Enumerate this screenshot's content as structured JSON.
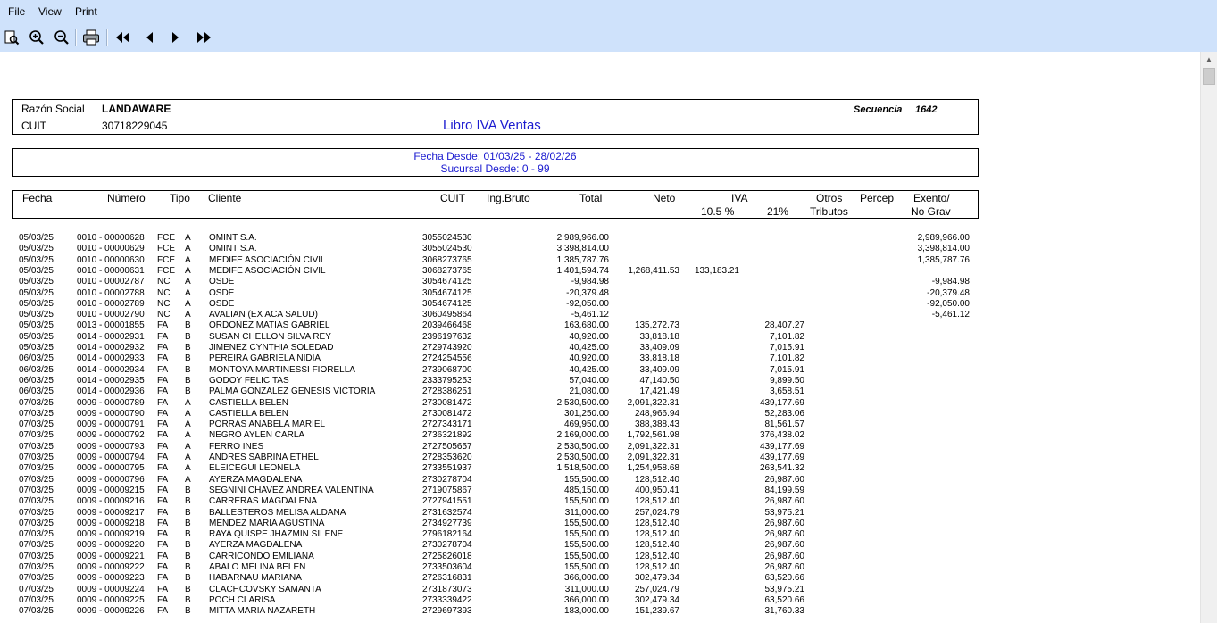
{
  "menu": [
    "File",
    "View",
    "Print"
  ],
  "toolbar": {
    "icons": [
      "page-preview-icon",
      "zoom-in-icon",
      "zoom-out-icon",
      "printer-icon",
      "first-page-icon",
      "previous-page-icon",
      "next-page-icon",
      "last-page-icon"
    ]
  },
  "report": {
    "razon_social_label": "Razón Social",
    "razon_social": "LANDAWARE",
    "cuit_label": "CUIT",
    "cuit": "30718229045",
    "title": "Libro IVA Ventas",
    "secuencia_label": "Secuencia",
    "secuencia": "1642",
    "fecha_desde": "Fecha Desde: 01/03/25 - 28/02/26",
    "sucursal_desde": "Sucursal Desde: 0 - 99"
  },
  "columns": {
    "fecha": "Fecha",
    "numero": "Número",
    "tipo": "Tipo",
    "cliente": "Cliente",
    "cuit": "CUIT",
    "ing_bruto": "Ing.Bruto",
    "total": "Total",
    "neto": "Neto",
    "iva": "IVA",
    "iva_105": "10.5 %",
    "iva_21": "21%",
    "otros": "Otros",
    "tributos": "Tributos",
    "percep": "Percep",
    "exento": "Exento/",
    "no_grav": "No Grav"
  },
  "rows": [
    [
      "05/03/25",
      "0010 - 00000628",
      "FCE",
      "A",
      "OMINT S.A.",
      "3055024530",
      "2,989,966.00",
      "",
      "",
      "",
      "2,989,966.00"
    ],
    [
      "05/03/25",
      "0010 - 00000629",
      "FCE",
      "A",
      "OMINT S.A.",
      "3055024530",
      "3,398,814.00",
      "",
      "",
      "",
      "3,398,814.00"
    ],
    [
      "05/03/25",
      "0010 - 00000630",
      "FCE",
      "A",
      "MEDIFE ASOCIACIÓN CIVIL",
      "3068273765",
      "1,385,787.76",
      "",
      "",
      "",
      "1,385,787.76"
    ],
    [
      "05/03/25",
      "0010 - 00000631",
      "FCE",
      "A",
      "MEDIFE ASOCIACIÓN CIVIL",
      "3068273765",
      "1,401,594.74",
      "1,268,411.53",
      "133,183.21",
      "",
      ""
    ],
    [
      "05/03/25",
      "0010 - 00002787",
      "NC",
      "A",
      "OSDE",
      "3054674125",
      "-9,984.98",
      "",
      "",
      "",
      "-9,984.98"
    ],
    [
      "05/03/25",
      "0010 - 00002788",
      "NC",
      "A",
      "OSDE",
      "3054674125",
      "-20,379.48",
      "",
      "",
      "",
      "-20,379.48"
    ],
    [
      "05/03/25",
      "0010 - 00002789",
      "NC",
      "A",
      "OSDE",
      "3054674125",
      "-92,050.00",
      "",
      "",
      "",
      "-92,050.00"
    ],
    [
      "05/03/25",
      "0010 - 00002790",
      "NC",
      "A",
      "AVALIAN (EX ACA SALUD)",
      "3060495864",
      "-5,461.12",
      "",
      "",
      "",
      "-5,461.12"
    ],
    [
      "05/03/25",
      "0013 - 00001855",
      "FA",
      "B",
      "ORDOÑEZ MATIAS GABRIEL",
      "2039466468",
      "163,680.00",
      "135,272.73",
      "",
      "28,407.27",
      ""
    ],
    [
      "05/03/25",
      "0014 - 00002931",
      "FA",
      "B",
      "SUSAN CHELLON SILVA REY",
      "2396197632",
      "40,920.00",
      "33,818.18",
      "",
      "7,101.82",
      ""
    ],
    [
      "05/03/25",
      "0014 - 00002932",
      "FA",
      "B",
      "JIMENEZ CYNTHIA SOLEDAD",
      "2729743920",
      "40,425.00",
      "33,409.09",
      "",
      "7,015.91",
      ""
    ],
    [
      "06/03/25",
      "0014 - 00002933",
      "FA",
      "B",
      "PEREIRA GABRIELA NIDIA",
      "2724254556",
      "40,920.00",
      "33,818.18",
      "",
      "7,101.82",
      ""
    ],
    [
      "06/03/25",
      "0014 - 00002934",
      "FA",
      "B",
      "MONTOYA MARTINESSI FIORELLA",
      "2739068700",
      "40,425.00",
      "33,409.09",
      "",
      "7,015.91",
      ""
    ],
    [
      "06/03/25",
      "0014 - 00002935",
      "FA",
      "B",
      "GODOY FELICITAS",
      "2333795253",
      "57,040.00",
      "47,140.50",
      "",
      "9,899.50",
      ""
    ],
    [
      "06/03/25",
      "0014 - 00002936",
      "FA",
      "B",
      "PALMA GONZALEZ GENESIS VICTORIA",
      "2728386251",
      "21,080.00",
      "17,421.49",
      "",
      "3,658.51",
      ""
    ],
    [
      "07/03/25",
      "0009 - 00000789",
      "FA",
      "A",
      "CASTIELLA BELEN",
      "2730081472",
      "2,530,500.00",
      "2,091,322.31",
      "",
      "439,177.69",
      ""
    ],
    [
      "07/03/25",
      "0009 - 00000790",
      "FA",
      "A",
      "CASTIELLA BELEN",
      "2730081472",
      "301,250.00",
      "248,966.94",
      "",
      "52,283.06",
      ""
    ],
    [
      "07/03/25",
      "0009 - 00000791",
      "FA",
      "A",
      "PORRAS ANABELA MARIEL",
      "2727343171",
      "469,950.00",
      "388,388.43",
      "",
      "81,561.57",
      ""
    ],
    [
      "07/03/25",
      "0009 - 00000792",
      "FA",
      "A",
      "NEGRO AYLEN CARLA",
      "2736321892",
      "2,169,000.00",
      "1,792,561.98",
      "",
      "376,438.02",
      ""
    ],
    [
      "07/03/25",
      "0009 - 00000793",
      "FA",
      "A",
      "FERRO INES",
      "2727505657",
      "2,530,500.00",
      "2,091,322.31",
      "",
      "439,177.69",
      ""
    ],
    [
      "07/03/25",
      "0009 - 00000794",
      "FA",
      "A",
      "ANDRES SABRINA ETHEL",
      "2728353620",
      "2,530,500.00",
      "2,091,322.31",
      "",
      "439,177.69",
      ""
    ],
    [
      "07/03/25",
      "0009 - 00000795",
      "FA",
      "A",
      "ELEICEGUI LEONELA",
      "2733551937",
      "1,518,500.00",
      "1,254,958.68",
      "",
      "263,541.32",
      ""
    ],
    [
      "07/03/25",
      "0009 - 00000796",
      "FA",
      "A",
      "AYERZA MAGDALENA",
      "2730278704",
      "155,500.00",
      "128,512.40",
      "",
      "26,987.60",
      ""
    ],
    [
      "07/03/25",
      "0009 - 00009215",
      "FA",
      "B",
      "SEGNINI CHAVEZ ANDREA VALENTINA",
      "2719075867",
      "485,150.00",
      "400,950.41",
      "",
      "84,199.59",
      ""
    ],
    [
      "07/03/25",
      "0009 - 00009216",
      "FA",
      "B",
      "CARRERAS MAGDALENA",
      "2727941551",
      "155,500.00",
      "128,512.40",
      "",
      "26,987.60",
      ""
    ],
    [
      "07/03/25",
      "0009 - 00009217",
      "FA",
      "B",
      "BALLESTEROS MELISA ALDANA",
      "2731632574",
      "311,000.00",
      "257,024.79",
      "",
      "53,975.21",
      ""
    ],
    [
      "07/03/25",
      "0009 - 00009218",
      "FA",
      "B",
      "MENDEZ MARIA AGUSTINA",
      "2734927739",
      "155,500.00",
      "128,512.40",
      "",
      "26,987.60",
      ""
    ],
    [
      "07/03/25",
      "0009 - 00009219",
      "FA",
      "B",
      "RAYA QUISPE JHAZMIN SILENE",
      "2796182164",
      "155,500.00",
      "128,512.40",
      "",
      "26,987.60",
      ""
    ],
    [
      "07/03/25",
      "0009 - 00009220",
      "FA",
      "B",
      "AYERZA MAGDALENA",
      "2730278704",
      "155,500.00",
      "128,512.40",
      "",
      "26,987.60",
      ""
    ],
    [
      "07/03/25",
      "0009 - 00009221",
      "FA",
      "B",
      "CARRICONDO EMILIANA",
      "2725826018",
      "155,500.00",
      "128,512.40",
      "",
      "26,987.60",
      ""
    ],
    [
      "07/03/25",
      "0009 - 00009222",
      "FA",
      "B",
      "ABALO MELINA BELEN",
      "2733503604",
      "155,500.00",
      "128,512.40",
      "",
      "26,987.60",
      ""
    ],
    [
      "07/03/25",
      "0009 - 00009223",
      "FA",
      "B",
      "HABARNAU MARIANA",
      "2726316831",
      "366,000.00",
      "302,479.34",
      "",
      "63,520.66",
      ""
    ],
    [
      "07/03/25",
      "0009 - 00009224",
      "FA",
      "B",
      "CLACHCOVSKY SAMANTA",
      "2731873073",
      "311,000.00",
      "257,024.79",
      "",
      "53,975.21",
      ""
    ],
    [
      "07/03/25",
      "0009 - 00009225",
      "FA",
      "B",
      "POCH CLARISA",
      "2733339422",
      "366,000.00",
      "302,479.34",
      "",
      "63,520.66",
      ""
    ],
    [
      "07/03/25",
      "0009 - 00009226",
      "FA",
      "B",
      "MITTA MARIA NAZARETH",
      "2729697393",
      "183,000.00",
      "151,239.67",
      "",
      "31,760.33",
      ""
    ]
  ]
}
